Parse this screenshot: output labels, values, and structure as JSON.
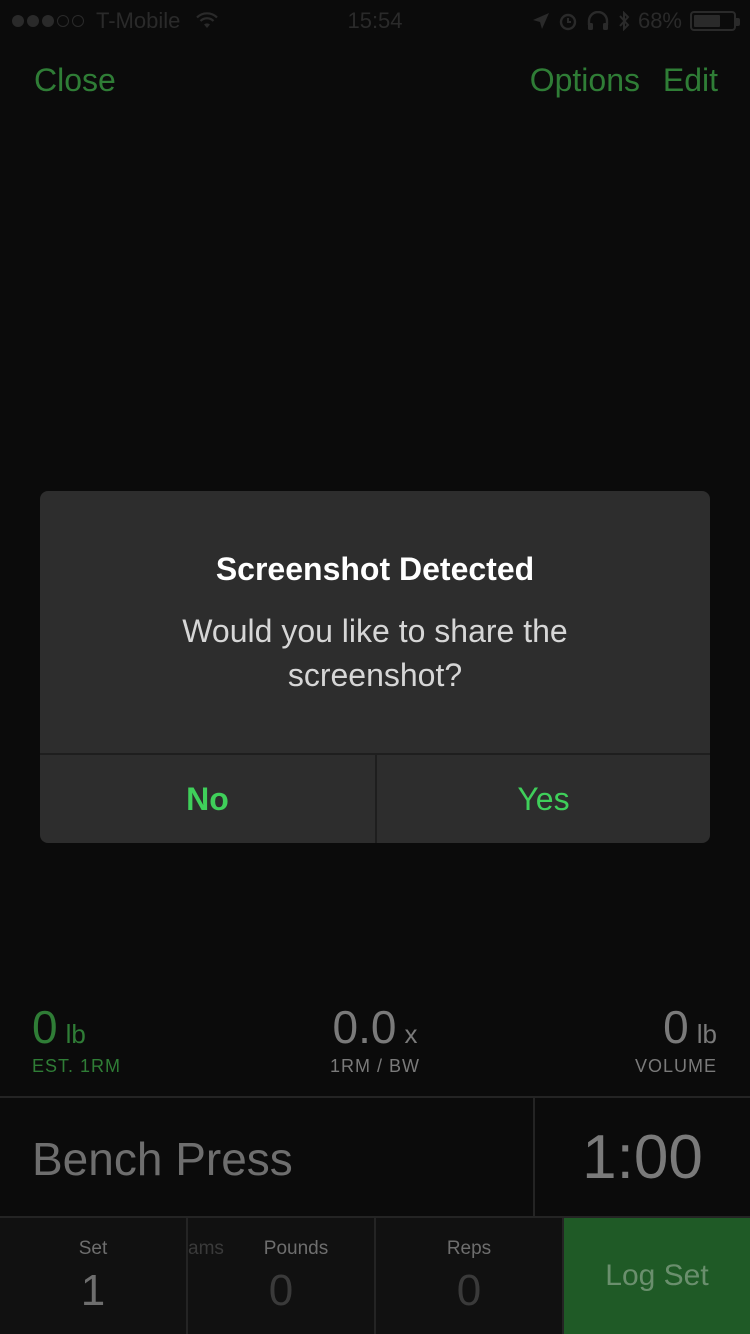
{
  "status_bar": {
    "carrier": "T-Mobile",
    "time": "15:54",
    "battery": "68%"
  },
  "nav": {
    "close": "Close",
    "options": "Options",
    "edit": "Edit"
  },
  "stats": {
    "est_1rm": {
      "value": "0",
      "unit": "lb",
      "label": "EST. 1RM"
    },
    "ratio": {
      "value": "0.0",
      "unit": "x",
      "label": "1RM / BW"
    },
    "volume": {
      "value": "0",
      "unit": "lb",
      "label": "VOLUME"
    }
  },
  "exercise": {
    "name": "Bench Press",
    "timer": "1:00"
  },
  "entry": {
    "set_label": "Set",
    "set_value": "1",
    "grams_label": "ams",
    "pounds_label": "Pounds",
    "pounds_value": "0",
    "reps_label": "Reps",
    "reps_value": "0",
    "log_set": "Log Set"
  },
  "dialog": {
    "title": "Screenshot Detected",
    "message": "Would you like to share the screenshot?",
    "no": "No",
    "yes": "Yes"
  },
  "colors": {
    "accent_green": "#3fcf5a",
    "dim_green": "#2f7d36",
    "background": "#0b0b0b"
  }
}
